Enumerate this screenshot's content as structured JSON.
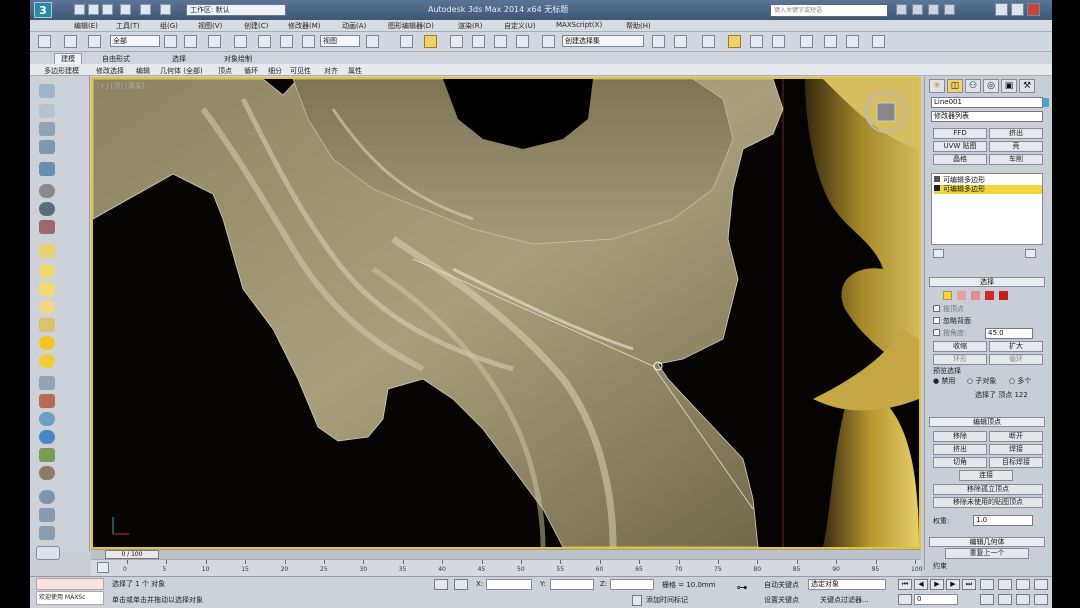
{
  "app": {
    "title": "Autodesk 3ds Max 2014 x64    无标题",
    "workspace": "工作区: 默认",
    "search_placeholder": "键入关键字或短语"
  },
  "menu": [
    "编辑(E)",
    "工具(T)",
    "组(G)",
    "视图(V)",
    "创建(C)",
    "修改器(M)",
    "动画(A)",
    "图形编辑器(D)",
    "渲染(R)",
    "自定义(U)",
    "MAXScript(X)",
    "帮助(H)"
  ],
  "toolbar": {
    "filter": "全部",
    "ref_coord": "视图",
    "named_selection": "创建选择集"
  },
  "ribbon": {
    "tabs": [
      "建模",
      "自由形式",
      "选择",
      "对象绘制"
    ],
    "subtools": [
      "多边形建模",
      "修改选择",
      "编辑",
      "几何体 (全部)",
      "顶点",
      "循环",
      "细分",
      "可见性",
      "对齐",
      "属性"
    ]
  },
  "viewport": {
    "label": "[+] [顶] [真实]"
  },
  "command_panel": {
    "object_name": "Line001",
    "modifier_list": "修改器列表",
    "btn_fillet": "FFD",
    "btn_extrude": "挤出",
    "btn_unwrap": "UVW 贴图",
    "btn_shell": "壳",
    "btn_lathe": "晶格",
    "btn_turbo": "车削",
    "stack": [
      "可编辑多边形",
      "可编辑多边形"
    ],
    "selection_title": "选择",
    "by_vertex": "按顶点",
    "ignore_backface": "忽略背面",
    "by_angle": "按角度:",
    "angle_value": "45.0",
    "shrink": "收缩",
    "grow": "扩大",
    "ring": "环形",
    "loop": "循环",
    "preview": "预览选择",
    "radio_off": "禁用",
    "radio_sub": "子对象",
    "radio_multi": "多个",
    "selected_count": "选择了 顶点 122",
    "edit_vertex_title": "编辑顶点",
    "remove": "移除",
    "break": "断开",
    "extrude": "挤出",
    "weld": "焊接",
    "chamfer": "切角",
    "target_weld": "目标焊接",
    "connect": "连接",
    "remove_iso": "移除孤立顶点",
    "remove_unused": "移除未使用的贴图顶点",
    "weight_label": "权重:",
    "weight_value": "1.0",
    "edit_geom_title": "编辑几何体",
    "repeat": "重复上一个",
    "constraints": "约束"
  },
  "timeline": {
    "frame": "0 / 100",
    "ticks": [
      "0",
      "5",
      "10",
      "15",
      "20",
      "25",
      "30",
      "35",
      "40",
      "45",
      "50",
      "55",
      "60",
      "65",
      "70",
      "75",
      "80",
      "85",
      "90",
      "95",
      "100"
    ]
  },
  "status": {
    "selected": "选择了 1 个 对象",
    "prompt": "单击或单击并拖动以选择对象",
    "x_label": "X:",
    "y_label": "Y:",
    "z_label": "Z:",
    "grid": "栅格 = 10.0mm",
    "add_time_tag": "添加时间标记",
    "auto_key": "自动关键点",
    "selected_obj": "选定对象",
    "set_key": "设置关键点",
    "key_filters": "关键点过滤器...",
    "frame_value": "0",
    "maxscript": "欢迎使用 MAXSc"
  }
}
